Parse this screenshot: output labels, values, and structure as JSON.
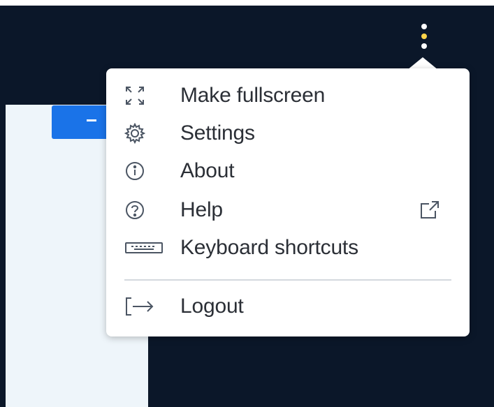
{
  "menu": {
    "items": [
      {
        "label": "Make fullscreen",
        "icon": "fullscreen-icon"
      },
      {
        "label": "Settings",
        "icon": "gear-icon"
      },
      {
        "label": "About",
        "icon": "info-icon"
      },
      {
        "label": "Help",
        "icon": "help-icon",
        "trailing_icon": "external-link-icon"
      },
      {
        "label": "Keyboard shortcuts",
        "icon": "keyboard-icon"
      }
    ],
    "logout": {
      "label": "Logout",
      "icon": "logout-icon"
    }
  },
  "colors": {
    "header_bg": "#0b1729",
    "menu_bg": "#ffffff",
    "accent_blue": "#1a73e8",
    "panel_bg": "#eef5fa",
    "kebab_highlight": "#ffd54a"
  }
}
